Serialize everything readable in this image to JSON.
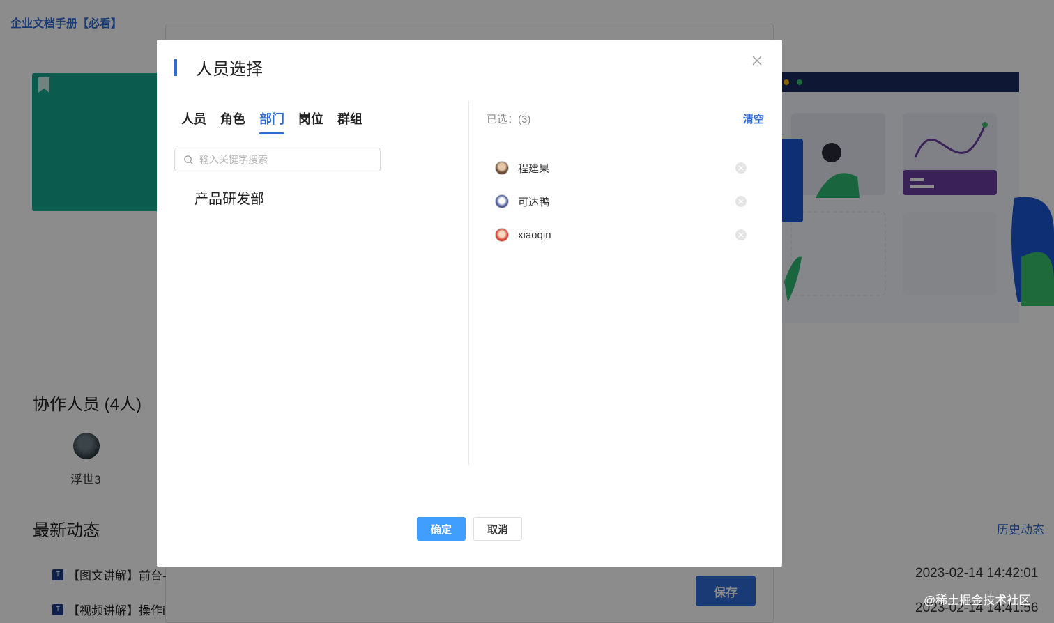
{
  "background": {
    "doc_title": "企业文档手册【必看】",
    "collaborators_title": "协作人员 (4人)",
    "collaborator_name": "浮世3",
    "news_title": "最新动态",
    "history_link": "历史动态",
    "news_items": [
      {
        "title": "【图文讲解】前台-",
        "time": "2023-02-14 14:42:01"
      },
      {
        "title": "【视频讲解】操作i",
        "time": "2023-02-14 14:41:56"
      }
    ],
    "save_label": "保存",
    "watermark": "@稀土掘金技术社区"
  },
  "modal": {
    "title": "人员选择",
    "tabs": [
      {
        "label": "人员",
        "active": false
      },
      {
        "label": "角色",
        "active": false
      },
      {
        "label": "部门",
        "active": true
      },
      {
        "label": "岗位",
        "active": false
      },
      {
        "label": "群组",
        "active": false
      }
    ],
    "search_placeholder": "输入关键字搜索",
    "departments": [
      "产品研发部"
    ],
    "selected_label": "已选：(3)",
    "clear_label": "清空",
    "selected": [
      {
        "name": "程建果"
      },
      {
        "name": "可达鸭"
      },
      {
        "name": "xiaoqin"
      }
    ],
    "confirm_label": "确定",
    "cancel_label": "取消"
  },
  "colors": {
    "accent": "#2f6bd6",
    "primary_button": "#409eff",
    "teal_card": "#14a88f"
  }
}
